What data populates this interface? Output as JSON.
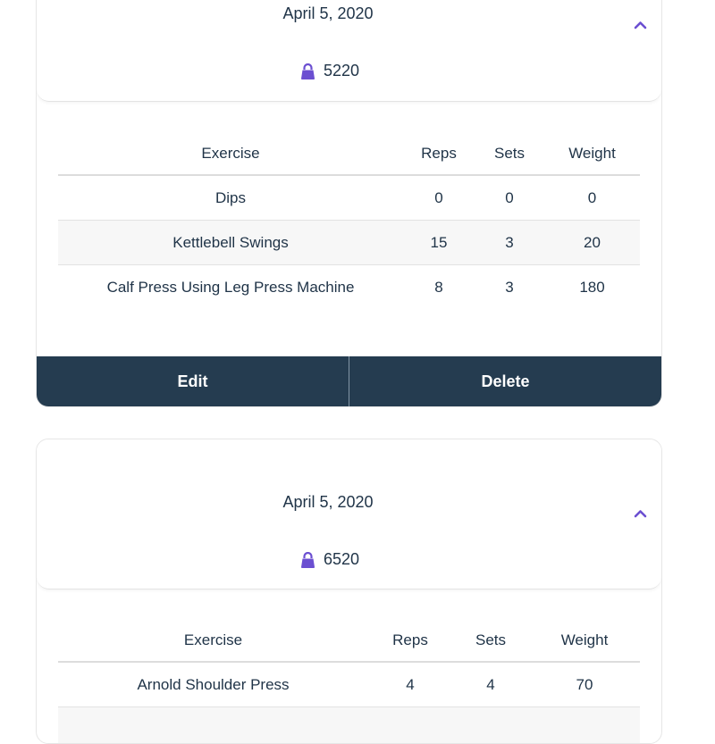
{
  "colors": {
    "accent": "#6b4fd1",
    "action_bar": "#253c50",
    "text": "#1f3347"
  },
  "workouts": [
    {
      "date": "April 5, 2020",
      "volume": "5220",
      "columns": [
        "Exercise",
        "Reps",
        "Sets",
        "Weight"
      ],
      "rows": [
        [
          "Dips",
          "0",
          "0",
          "0"
        ],
        [
          "Kettlebell Swings",
          "15",
          "3",
          "20"
        ],
        [
          "Calf Press Using Leg Press Machine",
          "8",
          "3",
          "180"
        ]
      ],
      "edit_label": "Edit",
      "delete_label": "Delete"
    },
    {
      "date": "April 5, 2020",
      "volume": "6520",
      "columns": [
        "Exercise",
        "Reps",
        "Sets",
        "Weight"
      ],
      "rows": [
        [
          "Arnold Shoulder Press",
          "4",
          "4",
          "70"
        ]
      ]
    }
  ],
  "icons": {
    "volume": "kettlebell-icon",
    "collapse": "chevron-up-icon"
  }
}
